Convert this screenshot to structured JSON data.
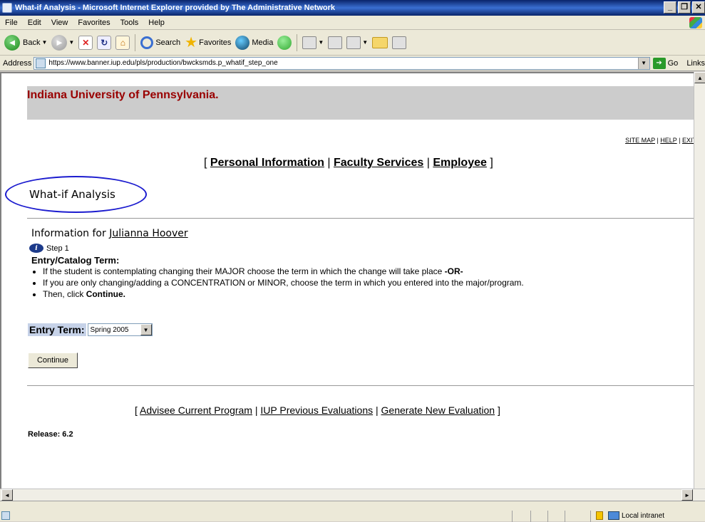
{
  "window": {
    "title": "What-if Analysis - Microsoft Internet Explorer provided by The Administrative Network"
  },
  "menu": [
    "File",
    "Edit",
    "View",
    "Favorites",
    "Tools",
    "Help"
  ],
  "toolbar": {
    "back": "Back",
    "search": "Search",
    "favorites": "Favorites",
    "media": "Media"
  },
  "address": {
    "label": "Address",
    "url": "https://www.banner.iup.edu/pls/production/bwcksmds.p_whatif_step_one",
    "go": "Go",
    "links": "Links"
  },
  "page": {
    "banner_title": "Indiana University of Pennsylvania.",
    "top_links": {
      "site_map": "SITE MAP",
      "help": "HELP",
      "exit": "EXIT"
    },
    "main_nav": {
      "personal": "Personal Information",
      "faculty": "Faculty Services",
      "employee": "Employee"
    },
    "heading": "What-if Analysis",
    "info_prefix": "Information for",
    "student_name": "Julianna Hoover",
    "step": "Step 1",
    "entry_catalog": "Entry/Catalog Term:",
    "bullet1": "If the student is contemplating changing their MAJOR choose the term in which the change will take place ",
    "bullet1_bold": "-OR-",
    "bullet2": "If you are only changing/adding a CONCENTRATION or MINOR, choose the term in which you entered into the major/program.",
    "bullet3": "Then, click ",
    "bullet3_bold": "Continue.",
    "entry_term_label": "Entry Term:",
    "entry_term_value": "Spring 2005",
    "continue_button": "Continue",
    "bottom_nav": {
      "advisee": "Advisee Current Program",
      "previous": "IUP Previous Evaluations",
      "generate": "Generate New Evaluation"
    },
    "release": "Release: 6.2"
  },
  "status": {
    "zone": "Local intranet"
  }
}
